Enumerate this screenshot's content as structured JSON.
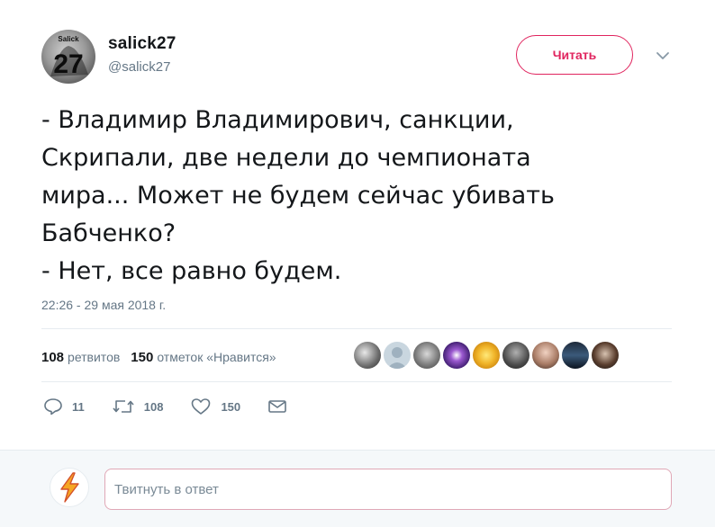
{
  "user": {
    "name": "salick27",
    "handle": "@salick27",
    "avatar_text": "Salick",
    "avatar_number": "27"
  },
  "follow_button": {
    "label": "Читать"
  },
  "tweet": {
    "lines": [
      "- Владимир Владимирович, санкции,",
      "Скрипали, две недели до чемпионата",
      "мира... Может не будем сейчас убивать",
      "Бабченко?",
      "- Нет, все равно будем."
    ],
    "timestamp": "22:26 - 29 мая 2018 г."
  },
  "stats": {
    "retweets_count": "108",
    "retweets_label": "ретвитов",
    "likes_count": "150",
    "likes_label": "отметок «Нравится»"
  },
  "actions": {
    "replies": "11",
    "retweets": "108",
    "likes": "150"
  },
  "reply": {
    "placeholder": "Твитнуть в ответ"
  },
  "colors": {
    "accent": "#e0245e",
    "muted": "#657786",
    "text": "#14171a",
    "divider": "#e6ecf0"
  }
}
